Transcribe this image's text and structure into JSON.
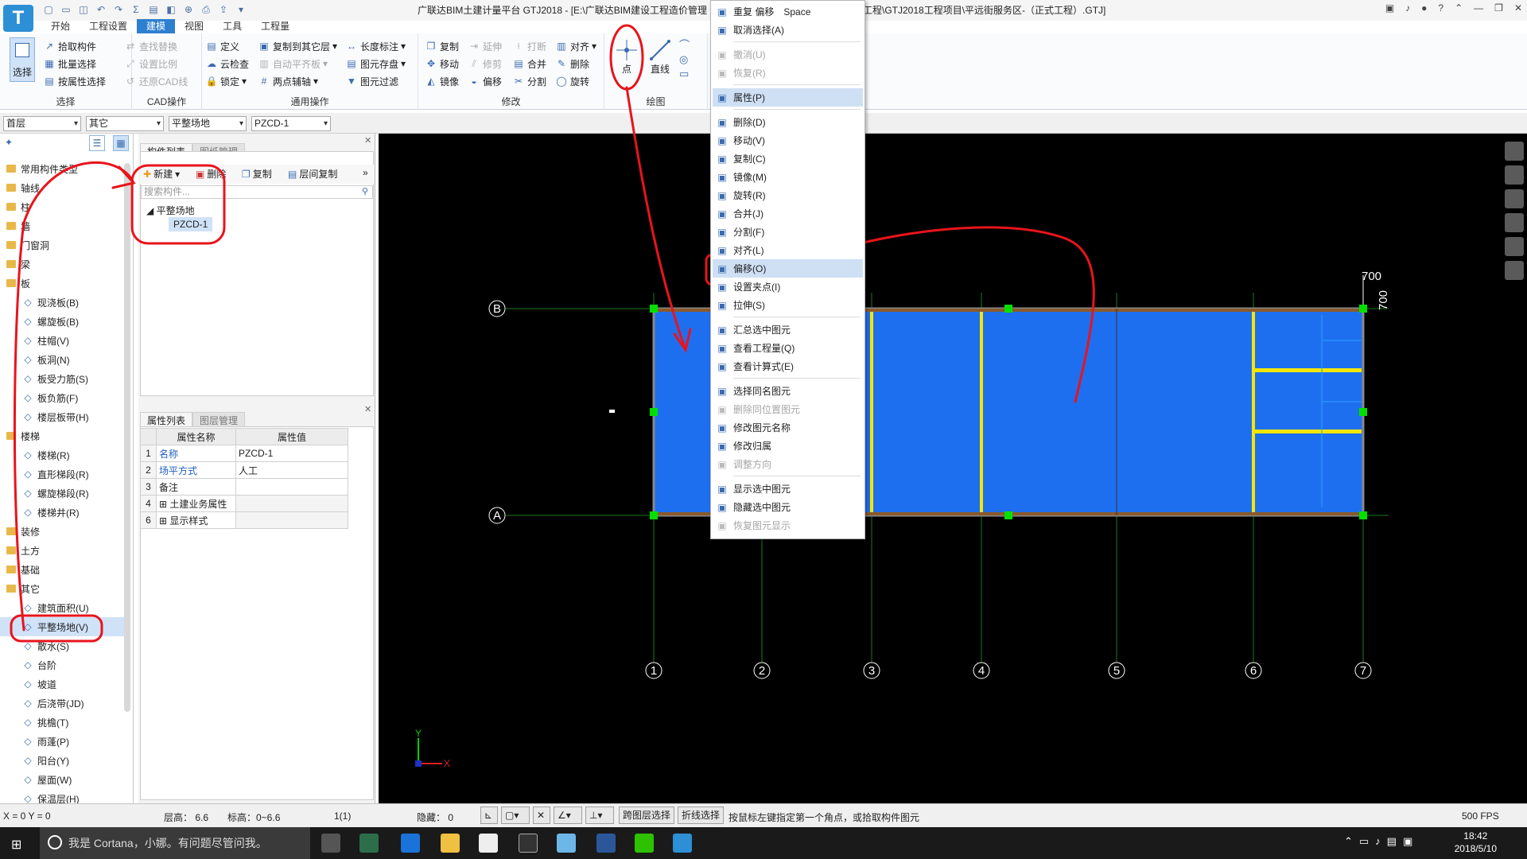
{
  "app": {
    "title": "广联达BIM土建计量平台 GTJ2018 - [E:\\广联达BIM建设工程造价管理",
    "title_tail": "工程\\GTJ2018工程项目\\平远街服务区-（正式工程）.GTJ]",
    "logo_letter": "T"
  },
  "tabs": [
    "开始",
    "工程设置",
    "建模",
    "视图",
    "工具",
    "工程量"
  ],
  "active_tab": "建模",
  "ribbon": {
    "select": {
      "big_label": "选择",
      "items": [
        "拾取构件",
        "批量选择",
        "按属性选择"
      ],
      "group": "选择"
    },
    "cad": {
      "items": [
        "查找替换",
        "设置比例",
        "还原CAD线"
      ],
      "group": "CAD操作"
    },
    "general": {
      "items": [
        "定义",
        "云检查",
        "锁定",
        "复制到其它层",
        "自动平齐板",
        "两点辅轴",
        "长度标注",
        "图元存盘",
        "图元过滤"
      ],
      "group": "通用操作"
    },
    "modify": {
      "items": [
        "复制",
        "延伸",
        "打断",
        "对齐",
        "移动",
        "修剪",
        "合并",
        "删除",
        "镜像",
        "偏移",
        "分割",
        "旋转"
      ],
      "group": "修改"
    },
    "draw": {
      "items": [
        "点",
        "直线"
      ],
      "group": "绘图"
    }
  },
  "toolbar2": {
    "floor": "首层",
    "category": "其它",
    "type": "平整场地",
    "component": "PZCD-1"
  },
  "nav": {
    "items": [
      {
        "kind": "cat",
        "label": "常用构件类型"
      },
      {
        "kind": "cat",
        "label": "轴线"
      },
      {
        "kind": "cat",
        "label": "柱"
      },
      {
        "kind": "cat",
        "label": "墙"
      },
      {
        "kind": "cat",
        "label": "门窗洞"
      },
      {
        "kind": "cat",
        "label": "梁"
      },
      {
        "kind": "cat",
        "label": "板"
      },
      {
        "kind": "sub",
        "label": "现浇板(B)"
      },
      {
        "kind": "sub",
        "label": "螺旋板(B)"
      },
      {
        "kind": "sub",
        "label": "柱帽(V)"
      },
      {
        "kind": "sub",
        "label": "板洞(N)"
      },
      {
        "kind": "sub",
        "label": "板受力筋(S)"
      },
      {
        "kind": "sub",
        "label": "板负筋(F)"
      },
      {
        "kind": "sub",
        "label": "楼层板带(H)"
      },
      {
        "kind": "cat",
        "label": "楼梯"
      },
      {
        "kind": "sub",
        "label": "楼梯(R)"
      },
      {
        "kind": "sub",
        "label": "直形梯段(R)"
      },
      {
        "kind": "sub",
        "label": "螺旋梯段(R)"
      },
      {
        "kind": "sub",
        "label": "楼梯井(R)"
      },
      {
        "kind": "cat",
        "label": "装修"
      },
      {
        "kind": "cat",
        "label": "土方"
      },
      {
        "kind": "cat",
        "label": "基础"
      },
      {
        "kind": "cat",
        "label": "其它"
      },
      {
        "kind": "sub",
        "label": "建筑面积(U)"
      },
      {
        "kind": "sub",
        "label": "平整场地(V)",
        "selected": true
      },
      {
        "kind": "sub",
        "label": "散水(S)"
      },
      {
        "kind": "sub",
        "label": "台阶"
      },
      {
        "kind": "sub",
        "label": "坡道"
      },
      {
        "kind": "sub",
        "label": "后浇带(JD)"
      },
      {
        "kind": "sub",
        "label": "挑檐(T)"
      },
      {
        "kind": "sub",
        "label": "雨蓬(P)"
      },
      {
        "kind": "sub",
        "label": "阳台(Y)"
      },
      {
        "kind": "sub",
        "label": "屋面(W)"
      },
      {
        "kind": "sub",
        "label": "保温层(H)"
      }
    ]
  },
  "complist": {
    "tabs": [
      "构件列表",
      "图纸管理"
    ],
    "tools": [
      "新建",
      "删除",
      "复制",
      "层间复制"
    ],
    "search_placeholder": "搜索构件...",
    "tree_root": "平整场地",
    "tree_child": "PZCD-1"
  },
  "props": {
    "tabs": [
      "属性列表",
      "图层管理"
    ],
    "head_name": "属性名称",
    "head_value": "属性值",
    "rows": [
      {
        "n": "1",
        "k": "名称",
        "v": "PZCD-1",
        "link": true
      },
      {
        "n": "2",
        "k": "场平方式",
        "v": "人工",
        "link": true
      },
      {
        "n": "3",
        "k": "备注",
        "v": "",
        "link": false
      },
      {
        "n": "4",
        "k": "土建业务属性",
        "v": "",
        "link": false,
        "expand": true
      },
      {
        "n": "6",
        "k": "显示样式",
        "v": "",
        "link": false,
        "expand": true
      }
    ]
  },
  "context_menu": [
    {
      "label": "重复 偏移",
      "shortcut": "Space",
      "icon": "repeat-icon"
    },
    {
      "label": "取消选择(A)",
      "icon": "deselect-icon"
    },
    {
      "sep": true
    },
    {
      "label": "撤消(U)",
      "disabled": true,
      "icon": "undo-icon"
    },
    {
      "label": "恢复(R)",
      "disabled": true,
      "icon": "redo-icon"
    },
    {
      "sep": true
    },
    {
      "label": "属性(P)",
      "highlight": true,
      "icon": "properties-icon"
    },
    {
      "sep": true
    },
    {
      "label": "删除(D)",
      "icon": "delete-icon"
    },
    {
      "label": "移动(V)",
      "icon": "move-icon"
    },
    {
      "label": "复制(C)",
      "icon": "copy-icon"
    },
    {
      "label": "镜像(M)",
      "icon": "mirror-icon"
    },
    {
      "label": "旋转(R)",
      "icon": "rotate-icon"
    },
    {
      "label": "合并(J)",
      "icon": "merge-icon"
    },
    {
      "label": "分割(F)",
      "icon": "split-icon"
    },
    {
      "label": "对齐(L)",
      "icon": "align-icon"
    },
    {
      "label": "偏移(O)",
      "highlight": true,
      "icon": "offset-icon"
    },
    {
      "label": "设置夹点(I)",
      "icon": "grip-icon"
    },
    {
      "label": "拉伸(S)",
      "icon": "stretch-icon"
    },
    {
      "sep": true
    },
    {
      "label": "汇总选中图元",
      "icon": "sum-icon"
    },
    {
      "label": "查看工程量(Q)",
      "icon": "quantity-icon"
    },
    {
      "label": "查看计算式(E)",
      "icon": "formula-icon"
    },
    {
      "sep": true
    },
    {
      "label": "选择同名图元",
      "icon": "select-same-icon"
    },
    {
      "label": "删除同位置图元",
      "disabled": true,
      "icon": "delete-same-icon"
    },
    {
      "label": "修改图元名称",
      "icon": "rename-icon"
    },
    {
      "label": "修改归属",
      "icon": "ownership-icon"
    },
    {
      "label": "调整方向",
      "disabled": true,
      "icon": "direction-icon"
    },
    {
      "sep": true
    },
    {
      "label": "显示选中图元",
      "icon": "show-icon"
    },
    {
      "label": "隐藏选中图元",
      "icon": "hide-icon"
    },
    {
      "label": "恢复图元显示",
      "disabled": true,
      "icon": "restore-icon"
    }
  ],
  "canvas": {
    "axis_rows": [
      "B",
      "A"
    ],
    "axis_cols": [
      "1",
      "2",
      "3",
      "4",
      "5",
      "6",
      "7"
    ],
    "dim_h": "700",
    "dim_v": "700",
    "axis_x": "X",
    "axis_y": "Y"
  },
  "status": {
    "coords": "X = 0 Y = 0",
    "floor_height": "层高： 6.6",
    "elevation": "标高：0~6.6",
    "count": "1(1)",
    "hidden": "隐藏： 0",
    "cross_layer": "跨图层选择",
    "polyline": "折线选择",
    "hint": "按鼠标左键指定第一个角点，或拾取构件图元",
    "fps": "500 FPS"
  },
  "taskbar": {
    "cortana": "我是 Cortana，小娜。有问题尽管问我。",
    "time": "18:42",
    "date": "2018/5/10"
  },
  "colors": {
    "accent": "#2d7fd0",
    "slab": "#1e6ff0",
    "beam": "#f5e600",
    "grip": "#00e000",
    "annot": "#e8141c",
    "axis": "#2aa52a"
  }
}
